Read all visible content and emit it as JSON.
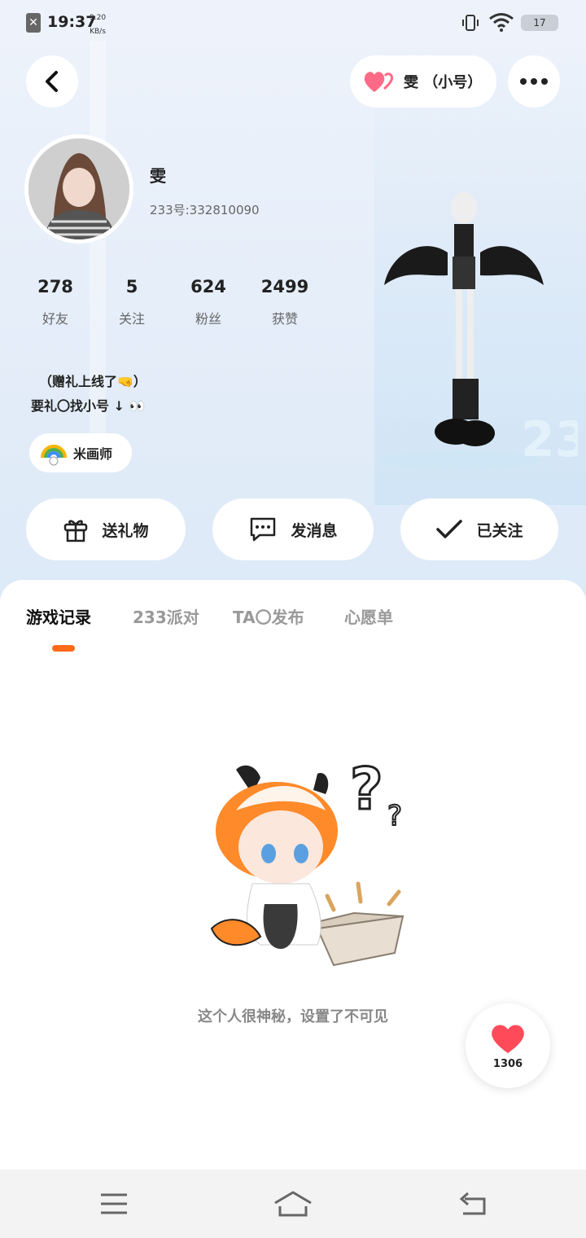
{
  "status_bar": {
    "time": "19:37",
    "speed_value": "9.20",
    "speed_unit": "KB/s",
    "battery": "17"
  },
  "top_bar": {
    "account_label": "雯 （小号）"
  },
  "profile": {
    "name": "雯",
    "uid": "233号:332810090",
    "stats": [
      {
        "value": "278",
        "label": "好友"
      },
      {
        "value": "5",
        "label": "关注"
      },
      {
        "value": "624",
        "label": "粉丝"
      },
      {
        "value": "2499",
        "label": "获赞"
      }
    ],
    "bio_line1": "（赠礼上线了🤜）",
    "bio_line2": "要礼〇找小号 ↓ 👀",
    "badge_label": "米画师"
  },
  "actions": {
    "gift": "送礼物",
    "message": "发消息",
    "followed": "已关注"
  },
  "tabs": [
    {
      "label": "游戏记录",
      "active": true
    },
    {
      "label": "233派对",
      "active": false
    },
    {
      "label": "TA〇发布",
      "active": false
    },
    {
      "label": "心愿单",
      "active": false
    }
  ],
  "empty_state": {
    "message": "这个人很神秘，设置了不可见"
  },
  "likes": {
    "count": "1306"
  },
  "colors": {
    "accent": "#ff6a1a",
    "heart": "#ff4a5a"
  }
}
